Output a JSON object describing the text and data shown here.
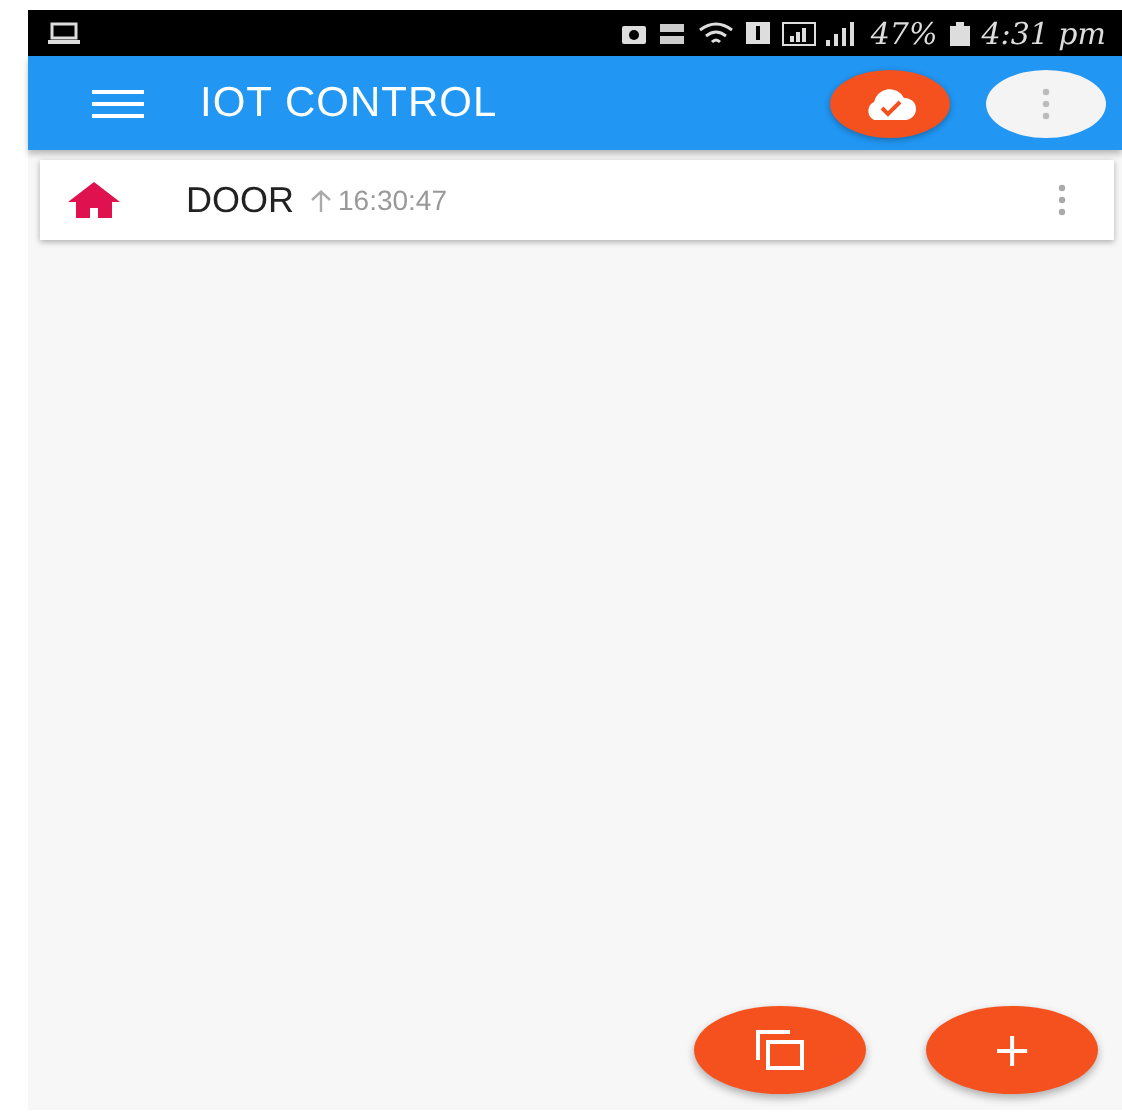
{
  "status_bar": {
    "battery": "47%",
    "time": "4:31 pm"
  },
  "toolbar": {
    "title": "IOT CONTROL",
    "cloud_synced": true
  },
  "devices": [
    {
      "name": "DOOR",
      "time": "16:30:47"
    }
  ],
  "fab": {
    "add_label": "+"
  }
}
